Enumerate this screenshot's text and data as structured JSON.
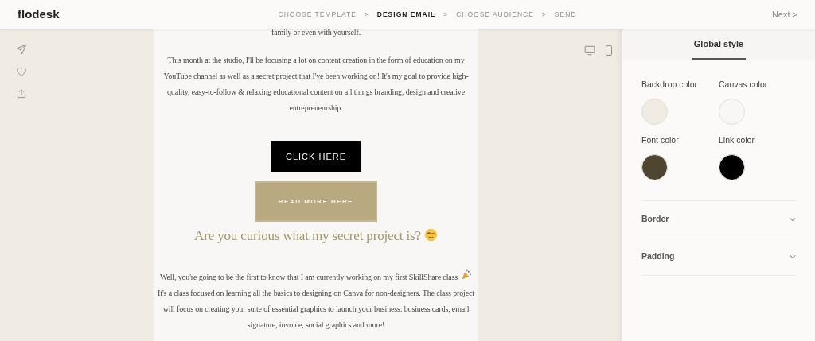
{
  "header": {
    "logo": "flodesk",
    "steps": [
      {
        "label": "CHOOSE TEMPLATE",
        "selected": false
      },
      {
        "label": "DESIGN EMAIL",
        "selected": true
      },
      {
        "label": "CHOOSE AUDIENCE",
        "selected": false
      },
      {
        "label": "SEND",
        "selected": false
      }
    ],
    "separator": ">",
    "next": "Next >"
  },
  "email": {
    "blocks": [
      {
        "kind": "paragraph",
        "text": "family or even with yourself."
      },
      {
        "kind": "paragraph",
        "text": "This month at the studio, I'll be focusing a lot on content creation in the form of education on my YouTube channel as well as a secret project that I've been working on! It's my goal to provide high-quality, easy-to-follow & relaxing educational content on all things branding, design and creative entrepreneurship."
      },
      {
        "kind": "dark_button",
        "text": "CLICK HERE"
      },
      {
        "kind": "textured_button",
        "text": "READ MORE HERE"
      },
      {
        "kind": "heading",
        "text": "Are you curious what my secret project is?"
      },
      {
        "kind": "paragraph",
        "text": "Well, you're going to be the first to know that I am currently working on my first SkillShare class"
      },
      {
        "kind": "paragraph",
        "text": "It's a class focused on learning all the basics to designing on Canva for non-designers. The class project will focus on creating your suite of essential graphics to launch your business: business cards, email signature, invoice, social graphics and more!"
      }
    ]
  },
  "panel": {
    "tabs": [
      {
        "label": "Global style",
        "selected": true
      }
    ],
    "swatches": [
      {
        "label": "Backdrop color",
        "color": "#f0ebe3"
      },
      {
        "label": "Canvas color",
        "color": "#f8f7f5"
      },
      {
        "label": "Font color",
        "color": "#4f4632"
      },
      {
        "label": "Link color",
        "color": "#000000"
      }
    ],
    "sections": [
      {
        "label": "Border",
        "expanded": false
      },
      {
        "label": "Padding",
        "expanded": false
      }
    ]
  }
}
